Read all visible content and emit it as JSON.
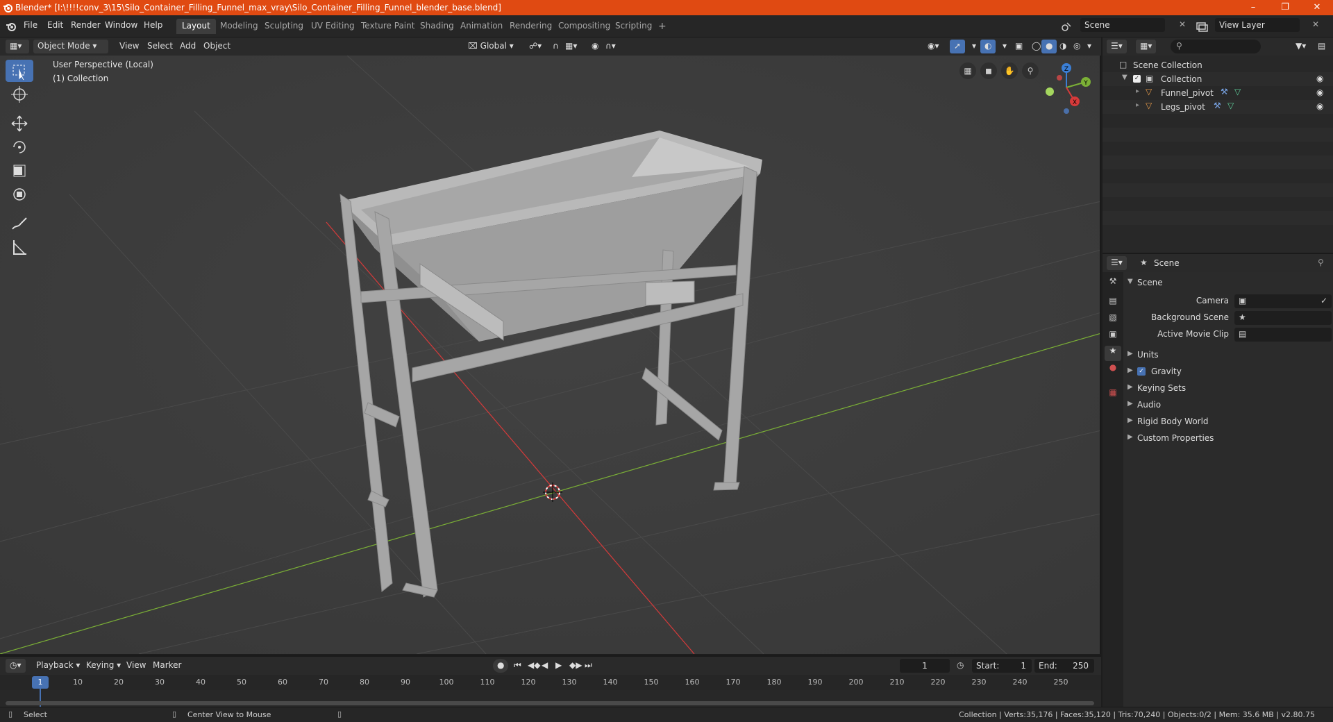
{
  "window": {
    "title": "Blender* [I:\\!!!!conv_3\\15\\Silo_Container_Filling_Funnel_max_vray\\Silo_Container_Filling_Funnel_blender_base.blend]",
    "minimize_icon": "minimize-icon",
    "restore_icon": "restore-icon",
    "close_icon": "close-icon",
    "accent": "#e04a12"
  },
  "menu": {
    "items": [
      "File",
      "Edit",
      "Render",
      "Window",
      "Help"
    ],
    "workspaces": [
      "Layout",
      "Modeling",
      "Sculpting",
      "UV Editing",
      "Texture Paint",
      "Shading",
      "Animation",
      "Rendering",
      "Compositing",
      "Scripting"
    ],
    "active_workspace": "Layout",
    "add_workspace": "+",
    "scene_name": "Scene",
    "view_layer": "View Layer"
  },
  "viewport_header": {
    "mode": "Object Mode",
    "menus": [
      "View",
      "Select",
      "Add",
      "Object"
    ],
    "transform_orientation": "Global"
  },
  "viewport": {
    "perspective_label": "User Perspective (Local)",
    "collection_label": "(1) Collection",
    "background": "#3d3d3d",
    "axis_x_color": "#d63a3a",
    "axis_y_color": "#7bb036",
    "axis_z_color": "#3b7fd6",
    "gizmo_x": "X",
    "gizmo_y": "Y",
    "gizmo_z": "Z"
  },
  "outliner": {
    "root": "Scene Collection",
    "collection": "Collection",
    "objects": [
      "Funnel_pivot",
      "Legs_pivot"
    ]
  },
  "properties": {
    "context": "Scene",
    "panel": "Scene",
    "fields": [
      {
        "label": "Camera"
      },
      {
        "label": "Background Scene"
      },
      {
        "label": "Active Movie Clip"
      }
    ],
    "subpanels": [
      "Units",
      "Gravity",
      "Keying Sets",
      "Audio",
      "Rigid Body World",
      "Custom Properties"
    ],
    "gravity_checked": true
  },
  "timeline": {
    "menus": [
      "Playback",
      "Keying",
      "View",
      "Marker"
    ],
    "current_frame": "1",
    "start_label": "Start:",
    "start": "1",
    "end_label": "End:",
    "end": "250",
    "ticks": [
      "1",
      "10",
      "20",
      "30",
      "40",
      "50",
      "60",
      "70",
      "80",
      "90",
      "100",
      "110",
      "120",
      "130",
      "140",
      "150",
      "160",
      "170",
      "180",
      "190",
      "200",
      "210",
      "220",
      "230",
      "240",
      "250"
    ]
  },
  "status": {
    "left_action": "Select",
    "middle_action": "Center View to Mouse",
    "stats": "Collection | Verts:35,176 | Faces:35,120 | Tris:70,240 | Objects:0/2 | Mem: 35.6 MB | v2.80.75"
  }
}
